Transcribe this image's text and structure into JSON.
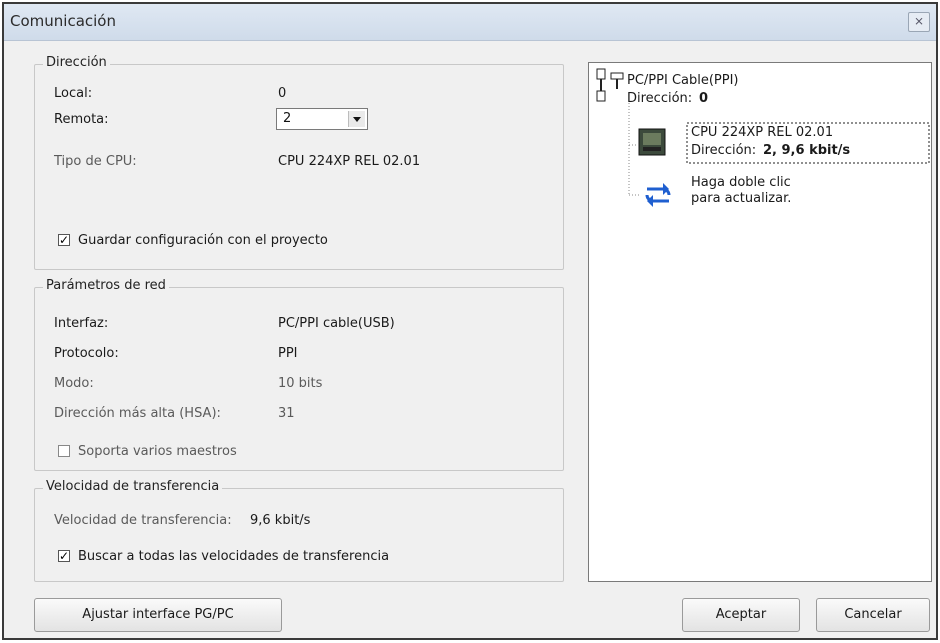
{
  "dialog": {
    "title": "Comunicación",
    "close_label": "⨯"
  },
  "direccion": {
    "legend": "Dirección",
    "local_label": "Local:",
    "local_value": "0",
    "remota_label": "Remota:",
    "remota_value": "2",
    "cpu_label": "Tipo de CPU:",
    "cpu_value": "CPU 224XP REL 02.01",
    "guardar_label": "Guardar configuración con el proyecto",
    "guardar_checked": true
  },
  "red": {
    "legend": "Parámetros de red",
    "interfaz_label": "Interfaz:",
    "interfaz_value": "PC/PPI cable(USB)",
    "protocolo_label": "Protocolo:",
    "protocolo_value": "PPI",
    "modo_label": "Modo:",
    "modo_value": "10 bits",
    "hsa_label": "Dirección más alta (HSA):",
    "hsa_value": "31",
    "maestros_label": "Soporta varios maestros",
    "maestros_checked": false
  },
  "velocidad": {
    "legend": "Velocidad de transferencia",
    "vel_label": "Velocidad de transferencia:",
    "vel_value": "9,6 kbit/s",
    "buscar_label": "Buscar a todas las velocidades de transferencia",
    "buscar_checked": true
  },
  "tree": {
    "cable_name": "PC/PPI Cable(PPI)",
    "cable_addr_label": "Dirección:",
    "cable_addr_value": "0",
    "cpu_name": "CPU 224XP REL 02.01",
    "cpu_addr_label": "Dirección:",
    "cpu_addr_value": "2, 9,6 kbit/s",
    "refresh_line1": "Haga doble clic",
    "refresh_line2": "para actualizar."
  },
  "buttons": {
    "ajustar": "Ajustar interface PG/PC",
    "aceptar": "Aceptar",
    "cancelar": "Cancelar"
  }
}
